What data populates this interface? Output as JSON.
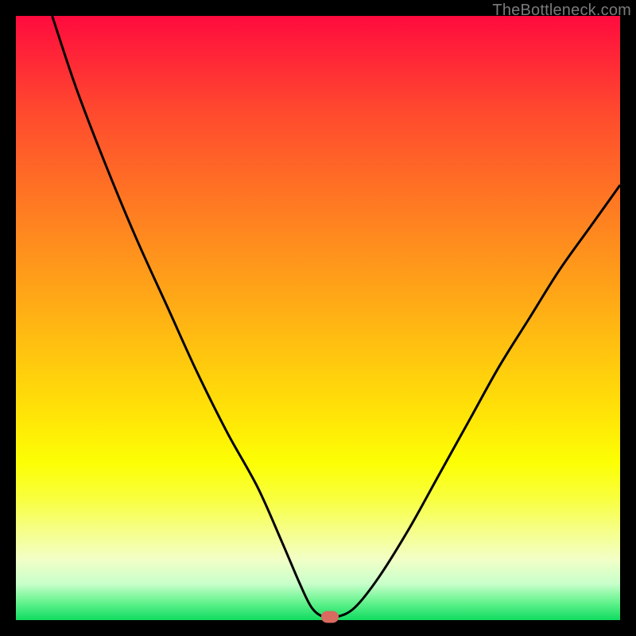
{
  "watermark": "TheBottleneck.com",
  "colors": {
    "frame": "#000000",
    "curve_stroke": "#000000",
    "marker_fill": "#d86a5f",
    "watermark_text": "#7a7a7a"
  },
  "chart_data": {
    "type": "line",
    "title": "",
    "xlabel": "",
    "ylabel": "",
    "xlim": [
      0,
      100
    ],
    "ylim": [
      0,
      100
    ],
    "grid": false,
    "legend": false,
    "series": [
      {
        "name": "bottleneck-curve",
        "x": [
          6,
          10,
          15,
          20,
          25,
          30,
          35,
          40,
          44,
          47,
          49,
          51,
          53,
          56,
          60,
          65,
          70,
          75,
          80,
          85,
          90,
          95,
          100
        ],
        "y": [
          100,
          88,
          75,
          63,
          52,
          41,
          31,
          22,
          13,
          6,
          2,
          0.5,
          0.5,
          2,
          7,
          15,
          24,
          33,
          42,
          50,
          58,
          65,
          72
        ]
      }
    ],
    "annotations": [
      {
        "name": "optimal-marker",
        "x": 52,
        "y": 0.5
      }
    ],
    "gradient_stops": [
      {
        "pct": 0,
        "color": "#ff0b3e"
      },
      {
        "pct": 8,
        "color": "#ff2b36"
      },
      {
        "pct": 16,
        "color": "#ff4a2e"
      },
      {
        "pct": 26,
        "color": "#ff6926"
      },
      {
        "pct": 36,
        "color": "#ff881f"
      },
      {
        "pct": 46,
        "color": "#ffa617"
      },
      {
        "pct": 56,
        "color": "#ffc50f"
      },
      {
        "pct": 66,
        "color": "#ffe407"
      },
      {
        "pct": 74,
        "color": "#fcff04"
      },
      {
        "pct": 80,
        "color": "#f8ff40"
      },
      {
        "pct": 85,
        "color": "#f6ff86"
      },
      {
        "pct": 90,
        "color": "#f2ffc7"
      },
      {
        "pct": 94,
        "color": "#c8ffca"
      },
      {
        "pct": 97,
        "color": "#66f38f"
      },
      {
        "pct": 100,
        "color": "#10dc60"
      }
    ]
  }
}
